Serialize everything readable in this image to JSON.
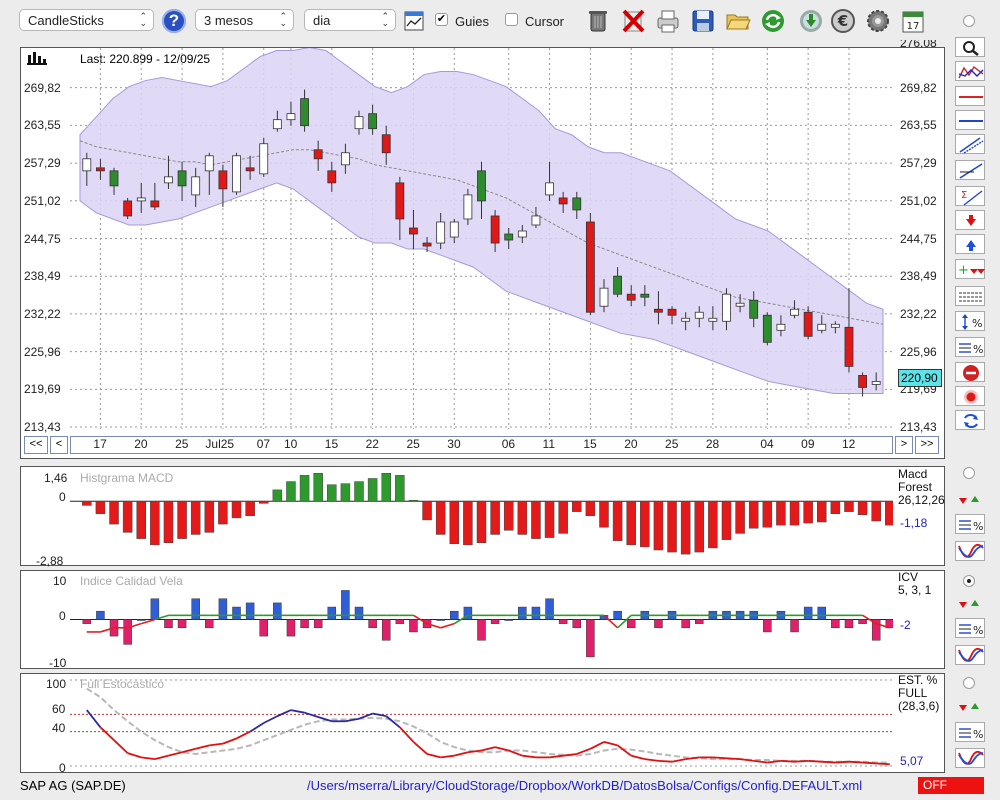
{
  "toolbar": {
    "chart_type": "CandleSticks",
    "period": "3 mesos",
    "interval": "dia",
    "guides_label": "Guies",
    "guides_checked": true,
    "cursor_label": "Cursor",
    "cursor_checked": false,
    "help_icon": "help-icon",
    "icons": [
      "chart-settings-icon",
      "trash-icon",
      "delete-icon",
      "print-icon",
      "save-icon",
      "folder-open-icon",
      "refresh-icon",
      "download-icon",
      "euro-icon",
      "gear-icon",
      "calendar-icon"
    ],
    "calendar_day": "17"
  },
  "main_chart": {
    "last_label": "Last: 220.899 - 12/09/25",
    "y_ticks": [
      "269,82",
      "263,55",
      "257,29",
      "251,02",
      "244,75",
      "238,49",
      "232,22",
      "225,96",
      "219,69",
      "213,43"
    ],
    "top_cut_tick": "276,08",
    "x_ticks": [
      "17",
      "20",
      "25",
      "Jul25",
      "07",
      "10",
      "15",
      "22",
      "25",
      "30",
      "06",
      "11",
      "15",
      "20",
      "25",
      "28",
      "04",
      "09",
      "12"
    ],
    "current_price": "220,90",
    "nav": {
      "first": "<<",
      "prev": "<",
      "next": ">",
      "last": ">>"
    },
    "colors": {
      "up": "#2e8b2e",
      "down": "#e01818",
      "band": "#dcd4f4",
      "band_line": "#a898d8"
    }
  },
  "chart_data": {
    "type": "candlestick",
    "title": "Last: 220.899 - 12/09/25",
    "ylim": [
      213.43,
      276.08
    ],
    "y_ticks": [
      269.82,
      263.55,
      257.29,
      251.02,
      244.75,
      238.49,
      232.22,
      225.96,
      219.69,
      213.43
    ],
    "x_ticks": [
      "17",
      "20",
      "25",
      "Jul25",
      "07",
      "10",
      "15",
      "22",
      "25",
      "30",
      "06",
      "11",
      "15",
      "20",
      "25",
      "28",
      "04",
      "09",
      "12"
    ],
    "last": 220.899,
    "candles": [
      {
        "o": 256.0,
        "c": 258.0,
        "h": 259.0,
        "l": 253.5
      },
      {
        "o": 256.5,
        "c": 256.0,
        "h": 258.0,
        "l": 254.5
      },
      {
        "o": 256.0,
        "c": 253.5,
        "h": 256.5,
        "l": 252.0
      },
      {
        "o": 251.0,
        "c": 248.5,
        "h": 251.5,
        "l": 248.0
      },
      {
        "o": 251.0,
        "c": 251.5,
        "h": 254.0,
        "l": 249.0
      },
      {
        "o": 251.0,
        "c": 250.0,
        "h": 254.0,
        "l": 249.5
      },
      {
        "o": 254.0,
        "c": 255.0,
        "h": 258.5,
        "l": 253.0
      },
      {
        "o": 256.0,
        "c": 253.5,
        "h": 257.5,
        "l": 251.0
      },
      {
        "o": 252.0,
        "c": 255.0,
        "h": 256.5,
        "l": 250.0
      },
      {
        "o": 256.0,
        "c": 258.5,
        "h": 259.0,
        "l": 252.0
      },
      {
        "o": 256.0,
        "c": 253.0,
        "h": 257.0,
        "l": 250.0
      },
      {
        "o": 252.5,
        "c": 258.5,
        "h": 259.0,
        "l": 252.0
      },
      {
        "o": 256.5,
        "c": 256.0,
        "h": 258.5,
        "l": 254.5
      },
      {
        "o": 255.5,
        "c": 260.5,
        "h": 261.5,
        "l": 255.0
      },
      {
        "o": 263.0,
        "c": 264.5,
        "h": 266.0,
        "l": 262.5
      },
      {
        "o": 264.5,
        "c": 265.5,
        "h": 267.5,
        "l": 263.5
      },
      {
        "o": 268.0,
        "c": 263.5,
        "h": 269.5,
        "l": 262.5
      },
      {
        "o": 259.5,
        "c": 258.0,
        "h": 261.0,
        "l": 256.0
      },
      {
        "o": 256.0,
        "c": 254.0,
        "h": 257.5,
        "l": 252.5
      },
      {
        "o": 257.0,
        "c": 259.0,
        "h": 260.5,
        "l": 255.5
      },
      {
        "o": 263.0,
        "c": 265.0,
        "h": 266.0,
        "l": 262.0
      },
      {
        "o": 265.5,
        "c": 263.0,
        "h": 267.0,
        "l": 262.0
      },
      {
        "o": 262.0,
        "c": 259.0,
        "h": 263.5,
        "l": 257.0
      },
      {
        "o": 254.0,
        "c": 248.0,
        "h": 255.0,
        "l": 244.5
      },
      {
        "o": 246.5,
        "c": 245.5,
        "h": 249.5,
        "l": 243.0
      },
      {
        "o": 244.0,
        "c": 243.5,
        "h": 245.0,
        "l": 242.5
      },
      {
        "o": 244.0,
        "c": 247.5,
        "h": 249.0,
        "l": 243.0
      },
      {
        "o": 245.0,
        "c": 247.5,
        "h": 248.0,
        "l": 244.0
      },
      {
        "o": 248.0,
        "c": 252.0,
        "h": 253.0,
        "l": 247.0
      },
      {
        "o": 256.0,
        "c": 251.0,
        "h": 257.5,
        "l": 248.0
      },
      {
        "o": 248.5,
        "c": 244.0,
        "h": 249.5,
        "l": 242.5
      },
      {
        "o": 245.5,
        "c": 244.5,
        "h": 246.5,
        "l": 243.0
      },
      {
        "o": 245.0,
        "c": 246.0,
        "h": 247.0,
        "l": 244.0
      },
      {
        "o": 247.0,
        "c": 248.5,
        "h": 250.0,
        "l": 246.5
      },
      {
        "o": 252.0,
        "c": 254.0,
        "h": 257.5,
        "l": 251.0
      },
      {
        "o": 251.5,
        "c": 250.5,
        "h": 252.5,
        "l": 249.0
      },
      {
        "o": 251.5,
        "c": 249.5,
        "h": 252.5,
        "l": 248.0
      },
      {
        "o": 247.5,
        "c": 232.5,
        "h": 249.0,
        "l": 232.0
      },
      {
        "o": 233.5,
        "c": 236.5,
        "h": 238.0,
        "l": 232.5
      },
      {
        "o": 238.5,
        "c": 235.5,
        "h": 240.0,
        "l": 235.0
      },
      {
        "o": 235.5,
        "c": 234.5,
        "h": 237.0,
        "l": 233.5
      },
      {
        "o": 235.5,
        "c": 235.0,
        "h": 237.0,
        "l": 233.5
      },
      {
        "o": 233.0,
        "c": 232.5,
        "h": 236.0,
        "l": 230.5
      },
      {
        "o": 233.0,
        "c": 232.0,
        "h": 233.5,
        "l": 230.5
      },
      {
        "o": 231.0,
        "c": 231.5,
        "h": 232.5,
        "l": 229.5
      },
      {
        "o": 231.5,
        "c": 232.5,
        "h": 233.5,
        "l": 230.0
      },
      {
        "o": 231.0,
        "c": 231.5,
        "h": 233.5,
        "l": 229.5
      },
      {
        "o": 231.0,
        "c": 235.5,
        "h": 236.5,
        "l": 229.5
      },
      {
        "o": 233.5,
        "c": 234.0,
        "h": 235.5,
        "l": 232.5
      },
      {
        "o": 234.5,
        "c": 231.5,
        "h": 236.0,
        "l": 230.0
      },
      {
        "o": 232.0,
        "c": 227.5,
        "h": 232.5,
        "l": 227.0
      },
      {
        "o": 229.5,
        "c": 230.5,
        "h": 232.0,
        "l": 228.5
      },
      {
        "o": 232.0,
        "c": 233.0,
        "h": 234.5,
        "l": 231.5
      },
      {
        "o": 232.5,
        "c": 228.5,
        "h": 233.5,
        "l": 228.0
      },
      {
        "o": 229.5,
        "c": 230.5,
        "h": 232.0,
        "l": 229.0
      },
      {
        "o": 230.0,
        "c": 230.5,
        "h": 231.0,
        "l": 229.0
      },
      {
        "o": 230.0,
        "c": 223.5,
        "h": 236.5,
        "l": 222.5
      },
      {
        "o": 222.0,
        "c": 220.0,
        "h": 222.5,
        "l": 218.5
      },
      {
        "o": 220.5,
        "c": 221.0,
        "h": 222.5,
        "l": 219.5
      }
    ],
    "band_upper": [
      262,
      265,
      268,
      270,
      271,
      271.5,
      271,
      270.5,
      270,
      271,
      273,
      275,
      276,
      276,
      276.5,
      276,
      274,
      272,
      270,
      269,
      270,
      272,
      272.5,
      272.5,
      272,
      271,
      270,
      268,
      266,
      263,
      262,
      260,
      259,
      259,
      258,
      257,
      256,
      254,
      252,
      250,
      248,
      247,
      246,
      244,
      242,
      240,
      238,
      236,
      234,
      233
    ],
    "band_lower": [
      251,
      249,
      248,
      247,
      247,
      247.5,
      248,
      249,
      250,
      251,
      252,
      253,
      254,
      253,
      251,
      249,
      247,
      245,
      244,
      244,
      243,
      243,
      242,
      241,
      240,
      238,
      236,
      235,
      234,
      233,
      232,
      231,
      230,
      229,
      228.5,
      228,
      227,
      226,
      225,
      224,
      223,
      222,
      221,
      220.5,
      220,
      219.5,
      219,
      219,
      219,
      219
    ],
    "ma": [
      261,
      260,
      259.5,
      259,
      258.5,
      258,
      257.5,
      257.5,
      257,
      257.5,
      258,
      258.5,
      259,
      259.5,
      259.5,
      259,
      258.5,
      258,
      257,
      256.5,
      256,
      255.5,
      255,
      254.5,
      253.5,
      252.5,
      251.5,
      250,
      248.5,
      247,
      245.5,
      244,
      243,
      242,
      241,
      240,
      239,
      238,
      237,
      236,
      235,
      234.5,
      234,
      233.5,
      233,
      232.5,
      232,
      231.5,
      231,
      230.5
    ]
  },
  "macd": {
    "title": "Histgrama MACD",
    "right_label_1": "Macd",
    "right_label_2": "Forest",
    "params": "26,12,26",
    "value": "-1,18",
    "ticks": [
      "1,46",
      "0",
      "-2,88"
    ],
    "bars": [
      -0.2,
      -0.6,
      -1.1,
      -1.5,
      -1.8,
      -2.1,
      -2.0,
      -1.8,
      -1.6,
      -1.5,
      -1.1,
      -0.8,
      -0.7,
      -0.1,
      0.55,
      0.95,
      1.25,
      1.35,
      0.8,
      0.85,
      0.95,
      1.1,
      1.35,
      1.25,
      0.05,
      -0.9,
      -1.6,
      -2.05,
      -2.1,
      -2.0,
      -1.6,
      -1.4,
      -1.6,
      -1.8,
      -1.75,
      -1.55,
      -0.5,
      -0.7,
      -1.25,
      -1.9,
      -2.1,
      -2.2,
      -2.35,
      -2.45,
      -2.55,
      -2.45,
      -2.25,
      -1.85,
      -1.55,
      -1.3,
      -1.25,
      -1.15,
      -1.15,
      -1.05,
      -1.0,
      -0.6,
      -0.5,
      -0.65,
      -0.95,
      -1.15
    ]
  },
  "icv": {
    "title": "Indice Calidad Vela",
    "right_label": "ICV",
    "params": "5, 3, 1",
    "value": "-2",
    "ticks": [
      "10",
      "0",
      "-10"
    ],
    "bars": [
      -1,
      2,
      -4,
      -6,
      0,
      5,
      -2,
      -2,
      5,
      -2,
      5,
      3,
      4,
      -4,
      4,
      -4,
      -2,
      -2,
      3,
      7,
      3,
      -2,
      -5,
      -1,
      -3,
      -2,
      0,
      2,
      3,
      -5,
      -1,
      0,
      3,
      3,
      5,
      -1,
      -2,
      -9,
      1,
      2,
      -2,
      2,
      -2,
      2,
      -2,
      -1,
      2,
      2,
      2,
      2,
      -3,
      2,
      -3,
      3,
      3,
      -2,
      -2,
      -1,
      -5,
      -2
    ],
    "line": [
      -3,
      -3,
      -2,
      -2,
      -1,
      0,
      1,
      1,
      1,
      1,
      1,
      1,
      1,
      1,
      1,
      1,
      1,
      1,
      1,
      1,
      1,
      1,
      1,
      1,
      1,
      -1,
      -2,
      -1,
      1,
      1,
      1,
      1,
      1,
      1,
      1,
      1,
      1,
      1,
      1,
      -2,
      1,
      1,
      1,
      1,
      1,
      1,
      1,
      1,
      1,
      1,
      1,
      1,
      1,
      1,
      1,
      1,
      1,
      1,
      -1,
      -2
    ]
  },
  "stoch": {
    "title": "Full Estocastico",
    "right_label_1": "EST. %",
    "right_label_2": "FULL",
    "params": "(28,3,6)",
    "value": "5,07",
    "ticks": [
      "100",
      "60",
      "40",
      "0"
    ],
    "k": [
      65,
      45,
      30,
      15,
      10,
      8,
      12,
      16,
      20,
      24,
      26,
      32,
      40,
      50,
      58,
      65,
      62,
      57,
      52,
      52,
      55,
      61,
      58,
      45,
      28,
      14,
      10,
      12,
      16,
      18,
      22,
      18,
      12,
      10,
      10,
      12,
      14,
      20,
      28,
      24,
      12,
      8,
      6,
      5,
      8,
      10,
      10,
      9,
      8,
      6,
      4,
      6,
      5,
      6,
      5,
      4,
      5,
      4,
      3,
      2
    ],
    "d": [
      90,
      80,
      65,
      52,
      40,
      30,
      22,
      16,
      14,
      16,
      18,
      20,
      24,
      30,
      36,
      42,
      48,
      52,
      54,
      54,
      55,
      56,
      55,
      52,
      46,
      38,
      28,
      22,
      18,
      16,
      16,
      18,
      18,
      16,
      14,
      13,
      12,
      14,
      18,
      20,
      19,
      17,
      14,
      12,
      10,
      9,
      8,
      8,
      8,
      7,
      7,
      6,
      6,
      6,
      5,
      5,
      5,
      5,
      4,
      4
    ]
  },
  "status": {
    "symbol": "SAP AG (SAP.DE)",
    "path": "/Users/mserra/Library/CloudStorage/Dropbox/WorkDB/DatosBolsa/Configs/Config.DEFAULT.xml",
    "state": "OFF"
  },
  "side_tools": [
    "zoom-icon",
    "bollinger-icon",
    "horizontal-line-red-icon",
    "horizontal-line-blue-icon",
    "channel-icon",
    "trendline-icon",
    "sigma-icon",
    "arrow-down-red-icon",
    "arrow-up-blue-icon",
    "add-signal-icon",
    "grid-lines-icon",
    "fibonacci-icon",
    "percent-lines-icon",
    "stop-icon",
    "record-icon",
    "swap-icon"
  ]
}
